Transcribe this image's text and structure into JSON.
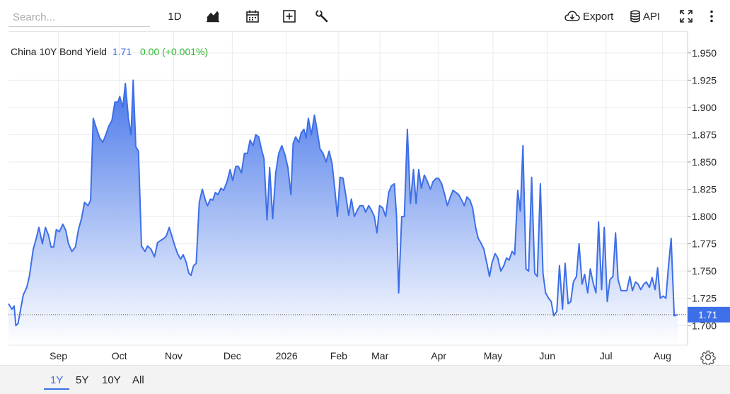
{
  "toolbar": {
    "search_placeholder": "Search...",
    "interval_label": "1D",
    "export_label": "Export",
    "api_label": "API"
  },
  "icons": {
    "chart_type": "area-chart-icon",
    "calendar": "calendar-icon",
    "add": "plus-box-icon",
    "tools": "wrench-icon",
    "export": "cloud-download-icon",
    "api": "database-icon",
    "fullscreen": "fullscreen-icon",
    "more": "more-vertical-icon",
    "settings": "gear-icon"
  },
  "colors": {
    "line": "#3d6fe8",
    "fill_top": "#3d6fe8",
    "fill_bottom": "#ffffff",
    "positive": "#2fb62f",
    "price_tag": "#3d6fe8"
  },
  "legend": {
    "name": "China 10Y Bond Yield",
    "value": "1.71",
    "change": "0.00 (+0.001%)"
  },
  "range_buttons": [
    "1Y",
    "5Y",
    "10Y",
    "All"
  ],
  "range_active": "1Y",
  "chart_data": {
    "type": "area",
    "series": [
      {
        "name": "China 10Y Bond Yield",
        "points": [
          [
            0,
            1.72
          ],
          [
            0.8,
            1.715
          ],
          [
            1.3,
            1.718
          ],
          [
            1.7,
            1.7
          ],
          [
            2.2,
            1.702
          ],
          [
            2.8,
            1.715
          ],
          [
            3.4,
            1.728
          ],
          [
            4.2,
            1.735
          ],
          [
            4.8,
            1.745
          ],
          [
            5.7,
            1.77
          ],
          [
            6.4,
            1.78
          ],
          [
            7.0,
            1.79
          ],
          [
            7.8,
            1.775
          ],
          [
            8.5,
            1.79
          ],
          [
            9.2,
            1.783
          ],
          [
            9.8,
            1.772
          ],
          [
            10.4,
            1.772
          ],
          [
            11.0,
            1.788
          ],
          [
            11.7,
            1.786
          ],
          [
            12.5,
            1.793
          ],
          [
            13.2,
            1.787
          ],
          [
            13.8,
            1.775
          ],
          [
            14.6,
            1.768
          ],
          [
            15.4,
            1.772
          ],
          [
            16.1,
            1.788
          ],
          [
            16.8,
            1.798
          ],
          [
            17.5,
            1.813
          ],
          [
            18.3,
            1.81
          ],
          [
            18.9,
            1.815
          ],
          [
            19.5,
            1.89
          ],
          [
            20.3,
            1.88
          ],
          [
            21.0,
            1.872
          ],
          [
            21.7,
            1.868
          ],
          [
            22.4,
            1.875
          ],
          [
            23.1,
            1.883
          ],
          [
            23.8,
            1.888
          ],
          [
            24.5,
            1.905
          ],
          [
            25.2,
            1.905
          ],
          [
            25.6,
            1.91
          ],
          [
            26.3,
            1.9
          ],
          [
            26.9,
            1.922
          ],
          [
            27.6,
            1.89
          ],
          [
            28.2,
            1.875
          ],
          [
            28.7,
            1.925
          ],
          [
            29.3,
            1.864
          ],
          [
            29.9,
            1.86
          ],
          [
            30.6,
            1.773
          ],
          [
            31.4,
            1.768
          ],
          [
            32.0,
            1.773
          ],
          [
            32.8,
            1.77
          ],
          [
            33.6,
            1.763
          ],
          [
            34.3,
            1.776
          ],
          [
            35.0,
            1.778
          ],
          [
            35.8,
            1.78
          ],
          [
            36.3,
            1.782
          ],
          [
            37.0,
            1.79
          ],
          [
            37.6,
            1.782
          ],
          [
            38.2,
            1.774
          ],
          [
            38.9,
            1.766
          ],
          [
            39.6,
            1.761
          ],
          [
            40.2,
            1.765
          ],
          [
            40.9,
            1.758
          ],
          [
            41.5,
            1.748
          ],
          [
            42.0,
            1.746
          ],
          [
            42.6,
            1.755
          ],
          [
            43.2,
            1.757
          ],
          [
            43.9,
            1.813
          ],
          [
            44.6,
            1.825
          ],
          [
            45.3,
            1.815
          ],
          [
            45.8,
            1.81
          ],
          [
            46.5,
            1.816
          ],
          [
            47.0,
            1.815
          ],
          [
            47.6,
            1.822
          ],
          [
            48.2,
            1.82
          ],
          [
            48.9,
            1.826
          ],
          [
            49.5,
            1.824
          ],
          [
            50.3,
            1.832
          ],
          [
            51.0,
            1.843
          ],
          [
            51.6,
            1.833
          ],
          [
            52.3,
            1.846
          ],
          [
            52.9,
            1.846
          ],
          [
            53.6,
            1.84
          ],
          [
            54.3,
            1.858
          ],
          [
            55.0,
            1.858
          ],
          [
            55.6,
            1.87
          ],
          [
            56.3,
            1.865
          ],
          [
            56.9,
            1.875
          ],
          [
            57.6,
            1.873
          ],
          [
            58.2,
            1.862
          ],
          [
            58.8,
            1.853
          ],
          [
            59.5,
            1.797
          ],
          [
            60.1,
            1.845
          ],
          [
            60.8,
            1.798
          ],
          [
            61.5,
            1.84
          ],
          [
            62.2,
            1.858
          ],
          [
            62.9,
            1.865
          ],
          [
            63.6,
            1.857
          ],
          [
            64.3,
            1.845
          ],
          [
            65.0,
            1.82
          ],
          [
            65.5,
            1.867
          ],
          [
            66.1,
            1.873
          ],
          [
            66.8,
            1.868
          ],
          [
            67.4,
            1.877
          ],
          [
            68.0,
            1.88
          ],
          [
            68.5,
            1.872
          ],
          [
            69.0,
            1.89
          ],
          [
            69.7,
            1.875
          ],
          [
            70.4,
            1.893
          ],
          [
            71.0,
            1.88
          ],
          [
            71.7,
            1.862
          ],
          [
            72.4,
            1.858
          ],
          [
            73.1,
            1.85
          ],
          [
            73.8,
            1.86
          ],
          [
            74.5,
            1.848
          ],
          [
            75.1,
            1.825
          ],
          [
            75.7,
            1.8
          ],
          [
            76.3,
            1.836
          ],
          [
            77.0,
            1.835
          ],
          [
            77.6,
            1.82
          ],
          [
            78.3,
            1.801
          ],
          [
            78.9,
            1.816
          ],
          [
            79.6,
            1.8
          ],
          [
            80.3,
            1.806
          ],
          [
            80.9,
            1.81
          ],
          [
            81.6,
            1.81
          ],
          [
            82.2,
            1.804
          ],
          [
            82.9,
            1.81
          ],
          [
            83.5,
            1.806
          ],
          [
            84.2,
            1.8
          ],
          [
            84.8,
            1.785
          ],
          [
            85.4,
            1.81
          ],
          [
            86.1,
            1.808
          ],
          [
            86.8,
            1.8
          ],
          [
            87.5,
            1.822
          ],
          [
            88.1,
            1.828
          ],
          [
            88.8,
            1.83
          ],
          [
            89.3,
            1.8
          ],
          [
            89.8,
            1.73
          ],
          [
            90.5,
            1.8
          ],
          [
            91.1,
            1.8
          ],
          [
            91.8,
            1.88
          ],
          [
            92.5,
            1.812
          ],
          [
            93.2,
            1.843
          ],
          [
            93.8,
            1.812
          ],
          [
            94.4,
            1.843
          ],
          [
            95.0,
            1.826
          ],
          [
            95.7,
            1.838
          ],
          [
            96.4,
            1.832
          ],
          [
            97.1,
            1.825
          ],
          [
            97.7,
            1.832
          ],
          [
            98.4,
            1.835
          ],
          [
            99.0,
            1.835
          ],
          [
            99.7,
            1.83
          ],
          [
            100.4,
            1.82
          ],
          [
            101.0,
            1.81
          ],
          [
            101.7,
            1.818
          ],
          [
            102.3,
            1.824
          ],
          [
            103.0,
            1.822
          ],
          [
            103.6,
            1.82
          ],
          [
            104.3,
            1.815
          ],
          [
            104.9,
            1.81
          ],
          [
            105.5,
            1.818
          ],
          [
            106.2,
            1.815
          ],
          [
            106.8,
            1.808
          ],
          [
            107.5,
            1.79
          ],
          [
            108.1,
            1.78
          ],
          [
            108.7,
            1.776
          ],
          [
            109.4,
            1.77
          ],
          [
            110.1,
            1.757
          ],
          [
            110.7,
            1.745
          ],
          [
            111.3,
            1.758
          ],
          [
            112.0,
            1.766
          ],
          [
            112.6,
            1.762
          ],
          [
            113.3,
            1.75
          ],
          [
            114.0,
            1.755
          ],
          [
            114.6,
            1.762
          ],
          [
            115.2,
            1.76
          ],
          [
            115.9,
            1.768
          ],
          [
            116.5,
            1.765
          ],
          [
            117.2,
            1.824
          ],
          [
            117.8,
            1.805
          ],
          [
            118.4,
            1.865
          ],
          [
            119.1,
            1.752
          ],
          [
            119.7,
            1.75
          ],
          [
            120.4,
            1.836
          ],
          [
            121.1,
            1.748
          ],
          [
            121.7,
            1.745
          ],
          [
            122.4,
            1.83
          ],
          [
            123.0,
            1.748
          ],
          [
            123.6,
            1.73
          ],
          [
            124.3,
            1.725
          ],
          [
            124.9,
            1.722
          ],
          [
            125.5,
            1.709
          ],
          [
            126.2,
            1.713
          ],
          [
            126.8,
            1.755
          ],
          [
            127.5,
            1.715
          ],
          [
            128.1,
            1.757
          ],
          [
            128.8,
            1.72
          ],
          [
            129.4,
            1.722
          ],
          [
            130.0,
            1.74
          ],
          [
            130.7,
            1.745
          ],
          [
            131.3,
            1.775
          ],
          [
            132.0,
            1.738
          ],
          [
            132.6,
            1.747
          ],
          [
            133.3,
            1.73
          ],
          [
            133.9,
            1.752
          ],
          [
            134.5,
            1.74
          ],
          [
            135.2,
            1.73
          ],
          [
            135.8,
            1.795
          ],
          [
            136.5,
            1.733
          ],
          [
            137.1,
            1.79
          ],
          [
            137.8,
            1.722
          ],
          [
            138.4,
            1.742
          ],
          [
            139.1,
            1.745
          ],
          [
            139.7,
            1.785
          ],
          [
            140.3,
            1.742
          ],
          [
            141.0,
            1.732
          ],
          [
            141.6,
            1.732
          ],
          [
            142.3,
            1.732
          ],
          [
            143.0,
            1.745
          ],
          [
            143.6,
            1.732
          ],
          [
            144.3,
            1.74
          ],
          [
            144.9,
            1.738
          ],
          [
            145.5,
            1.733
          ],
          [
            146.2,
            1.738
          ],
          [
            146.8,
            1.74
          ],
          [
            147.5,
            1.735
          ],
          [
            148.1,
            1.744
          ],
          [
            148.8,
            1.733
          ],
          [
            149.4,
            1.753
          ],
          [
            150.0,
            1.725
          ],
          [
            150.7,
            1.727
          ],
          [
            151.3,
            1.725
          ],
          [
            151.9,
            1.755
          ],
          [
            152.5,
            1.78
          ],
          [
            153.2,
            1.709
          ],
          [
            154.0,
            1.71
          ]
        ]
      }
    ],
    "x_ticks": [
      "Sep",
      "Oct",
      "Nov",
      "Dec",
      "2026",
      "Feb",
      "Mar",
      "Apr",
      "May",
      "Jun",
      "Jul",
      "Aug"
    ],
    "x_tick_positions": [
      11.5,
      25.5,
      38.0,
      51.5,
      64.0,
      76.0,
      85.5,
      99.0,
      111.5,
      124.0,
      137.5,
      150.5
    ],
    "x_range": [
      0,
      154
    ],
    "y_ticks": [
      "1.700",
      "1.725",
      "1.750",
      "1.775",
      "1.800",
      "1.825",
      "1.850",
      "1.875",
      "1.900",
      "1.925",
      "1.950"
    ],
    "ylim": [
      1.682,
      1.97
    ],
    "last_value": 1.71,
    "last_value_label": "1.71",
    "grid": true
  }
}
